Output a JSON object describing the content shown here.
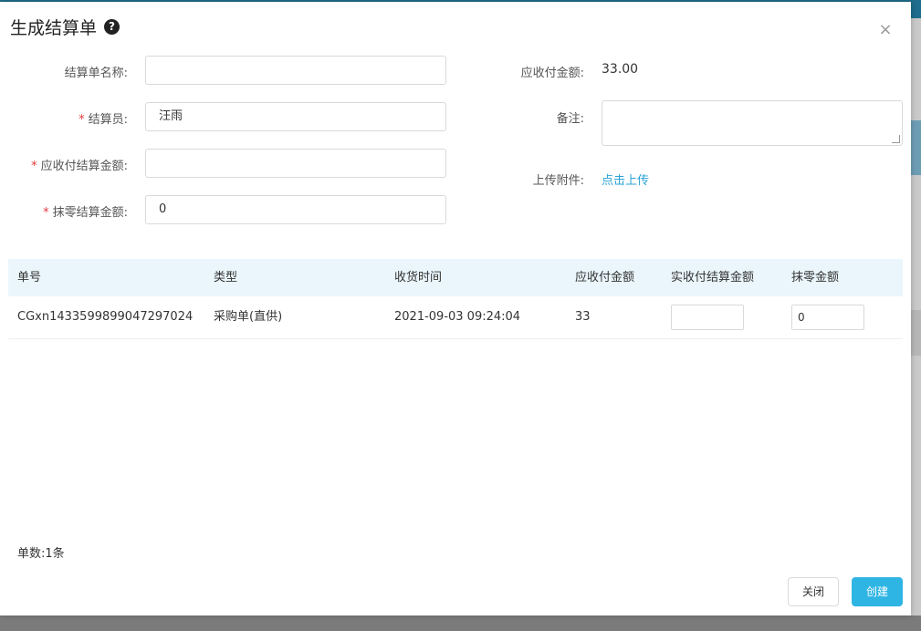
{
  "dialog": {
    "title": "生成结算单",
    "help_icon": "question-circle-icon",
    "close_icon": "close-icon",
    "close_glyph": "×"
  },
  "form": {
    "name_label": "结算单名称:",
    "name_value": "",
    "settler_label": "结算员:",
    "settler_value": "汪雨",
    "due_settle_label": "应收付结算金额:",
    "due_settle_value": "",
    "rounding_label": "抹零结算金额:",
    "rounding_value": "0",
    "required_mark": "*",
    "receivable_label": "应收付金额:",
    "receivable_value": "33.00",
    "remark_label": "备注:",
    "remark_value": "",
    "attachment_label": "上传附件:",
    "upload_link": "点击上传"
  },
  "table": {
    "headers": [
      "单号",
      "类型",
      "收货时间",
      "应收付金额",
      "实收付结算金额",
      "抹零金额"
    ],
    "rows": [
      {
        "order_no": "CGxn1433599899047297024",
        "type": "采购单(直供)",
        "receive_time": "2021-09-03 09:24:04",
        "amount": "33",
        "actual_settle": "",
        "rounding": "0"
      }
    ]
  },
  "footer": {
    "count_text": "单数:1条",
    "close_button": "关闭",
    "create_button": "创建"
  },
  "colors": {
    "accent": "#2fb5e4",
    "required": "#e4393c",
    "link": "#2aa3d8",
    "table_header_bg": "#eaf6fb"
  }
}
